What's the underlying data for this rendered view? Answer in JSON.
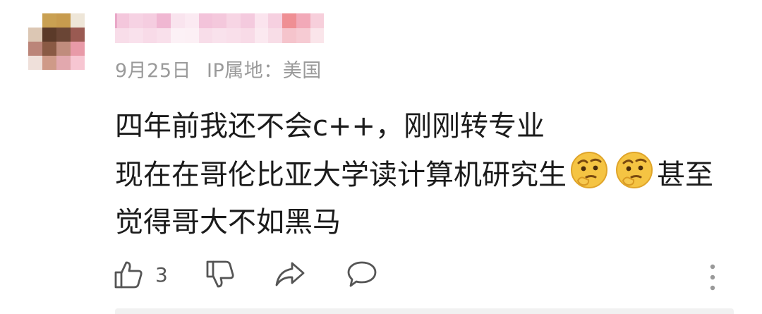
{
  "comment": {
    "meta": {
      "date": "9月25日",
      "ip": "IP属地：美国"
    },
    "lines": {
      "line1": "四年前我还不会c++，刚刚转专业",
      "line2": "现在在哥伦比亚大学读计算机研究生",
      "line2_tail": "甚至",
      "line3": "觉得哥大不如黑马"
    },
    "emojis": [
      "thinking-emoji",
      "thinking-emoji"
    ]
  },
  "actions": {
    "like_count": "3",
    "icons": [
      "thumbs-up-icon",
      "thumbs-down-icon",
      "share-icon",
      "comment-icon",
      "more-vertical-icon"
    ]
  },
  "colors": {
    "text": "#1b1b1b",
    "meta": "#9a9a9a",
    "icon": "#555555",
    "emoji": "#f5c443"
  }
}
